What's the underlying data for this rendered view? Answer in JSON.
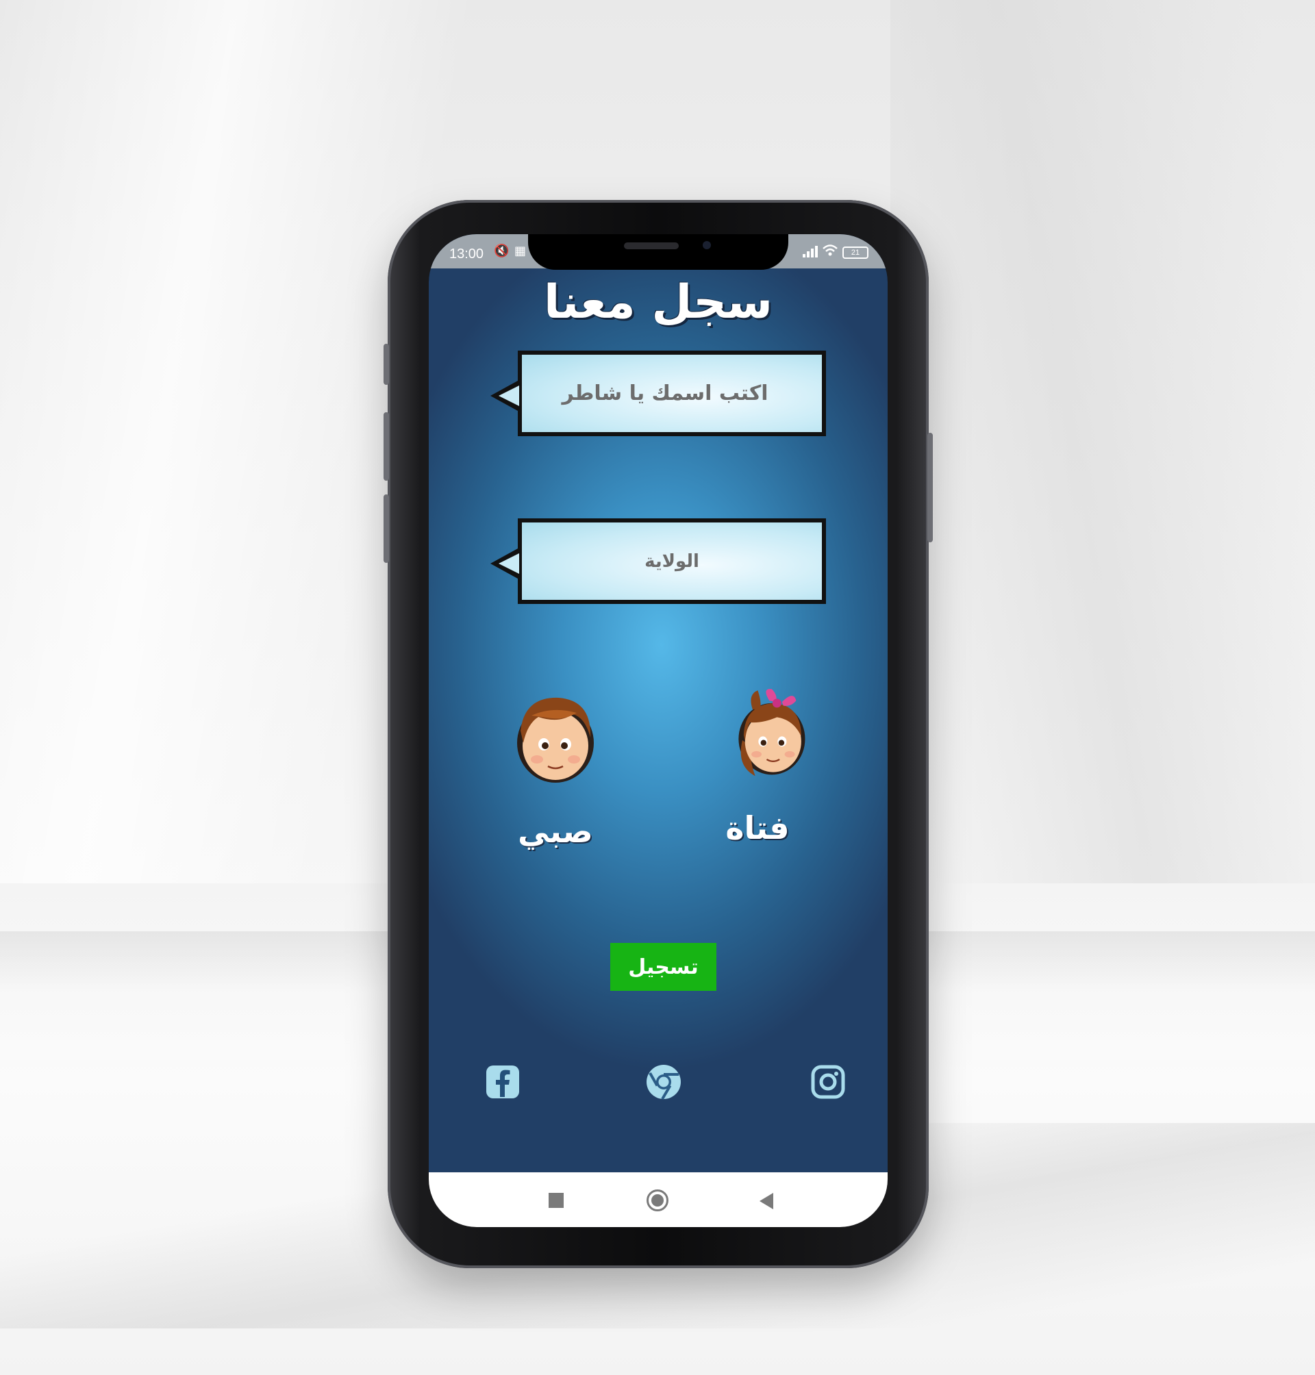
{
  "status_bar": {
    "time": "13:00",
    "battery": "21",
    "icons": [
      "mute-icon",
      "grid-icon",
      "signal-icon",
      "wifi-icon",
      "battery-icon"
    ]
  },
  "app": {
    "title": "سجل معنا",
    "name_field": {
      "placeholder": "اكتب اسمك يا شاطر"
    },
    "state_field": {
      "placeholder": "الولاية"
    },
    "gender_options": [
      {
        "label": "صبي",
        "icon": "boy-avatar-icon"
      },
      {
        "label": "فتاة",
        "icon": "girl-avatar-icon"
      }
    ],
    "register_label": "تسجيل",
    "social": [
      "facebook-icon",
      "chrome-icon",
      "instagram-icon"
    ]
  },
  "nav_bar": {
    "buttons": [
      "recents-square-icon",
      "home-circle-icon",
      "back-triangle-icon"
    ]
  },
  "colors": {
    "background_accent": "#55b8e8",
    "background_dark": "#213f66",
    "register_button": "#17b414",
    "bubble_fill": "#c9ebf6"
  }
}
